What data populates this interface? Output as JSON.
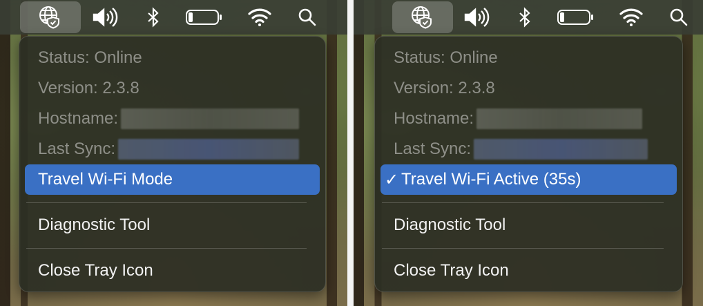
{
  "panels": [
    {
      "menubar": {
        "icons": [
          "globe-shield-icon",
          "volume-icon",
          "bluetooth-icon",
          "battery-icon",
          "wifi-icon",
          "search-icon"
        ]
      },
      "menu": {
        "status": "Status: Online",
        "version": "Version: 2.3.8",
        "hostname_label": "Hostname:",
        "last_sync_label": "Last Sync:",
        "travel_item": "Travel Wi-Fi Mode",
        "travel_checked": false,
        "diagnostic": "Diagnostic Tool",
        "close": "Close Tray Icon"
      }
    },
    {
      "menubar": {
        "icons": [
          "globe-shield-icon",
          "volume-icon",
          "bluetooth-icon",
          "battery-icon",
          "wifi-icon",
          "search-icon"
        ]
      },
      "menu": {
        "status": "Status: Online",
        "version": "Version: 2.3.8",
        "hostname_label": "Hostname:",
        "last_sync_label": "Last Sync:",
        "travel_check": "✓",
        "travel_item": "Travel Wi-Fi Active (35s)",
        "travel_checked": true,
        "diagnostic": "Diagnostic Tool",
        "close": "Close Tray Icon"
      }
    }
  ],
  "colors": {
    "selection": "#3a70c4",
    "menu_background": "#2c2e24",
    "disabled_text": "#8e8f88"
  }
}
